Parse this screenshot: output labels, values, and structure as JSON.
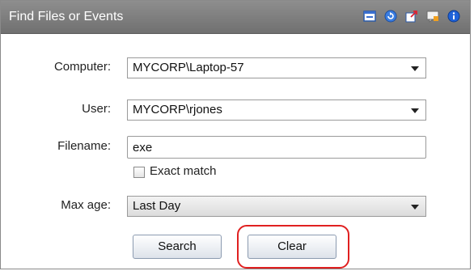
{
  "header": {
    "title": "Find Files or Events",
    "icons": [
      "window-icon",
      "refresh-icon",
      "external-link-icon",
      "comment-icon",
      "info-icon"
    ]
  },
  "form": {
    "computer_label": "Computer:",
    "computer_value": "MYCORP\\Laptop-57",
    "user_label": "User:",
    "user_value": "MYCORP\\rjones",
    "filename_label": "Filename:",
    "filename_value": "exe",
    "exact_match_label": "Exact match",
    "max_age_label": "Max age:",
    "max_age_value": "Last Day"
  },
  "buttons": {
    "search_label": "Search",
    "clear_label": "Clear"
  },
  "colors": {
    "header_bg": "#7d7d7d",
    "highlight": "#e02020"
  }
}
